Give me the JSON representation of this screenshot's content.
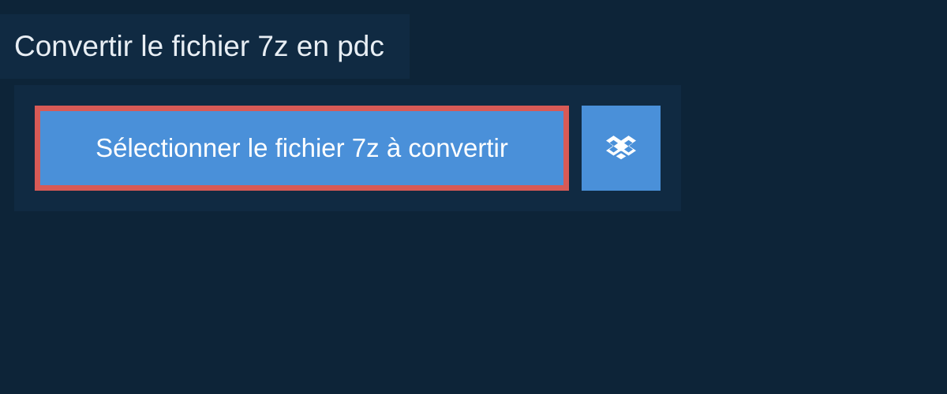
{
  "header": {
    "title": "Convertir le fichier 7z en pdc"
  },
  "actions": {
    "select_file_label": "Sélectionner le fichier 7z à convertir"
  },
  "colors": {
    "background": "#0d2438",
    "panel": "#102a42",
    "button_primary": "#4a90d9",
    "button_highlight_border": "#d85a56",
    "text_light": "#e8eef4"
  }
}
